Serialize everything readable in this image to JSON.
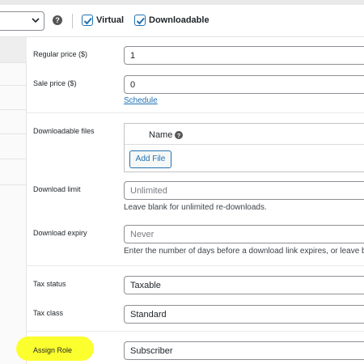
{
  "topbar": {
    "product_type_select": {
      "value": "",
      "icon": "chevron-down-icon"
    },
    "help_icon": "question-circle-icon",
    "virtual": {
      "label": "Virtual",
      "checked": true
    },
    "downloadable": {
      "label": "Downloadable",
      "checked": true
    }
  },
  "fields": {
    "regular_price": {
      "label": "Regular price ($)",
      "value": "1"
    },
    "sale_price": {
      "label": "Sale price ($)",
      "value": "0",
      "link": "Schedule"
    },
    "downloadable_files": {
      "label": "Downloadable files",
      "column_name": "Name",
      "add_button": "Add File"
    },
    "download_limit": {
      "label": "Download limit",
      "placeholder": "Unlimited",
      "hint": "Leave blank for unlimited re-downloads."
    },
    "download_expiry": {
      "label": "Download expiry",
      "placeholder": "Never",
      "hint": "Enter the number of days before a download link expires, or leave b"
    },
    "tax_status": {
      "label": "Tax status",
      "value": "Taxable"
    },
    "tax_class": {
      "label": "Tax class",
      "value": "Standard"
    },
    "assign_role": {
      "label": "Assign Role",
      "value": "Subscriber"
    }
  },
  "colors": {
    "accent": "#2271b1",
    "highlight": "#fcff2e"
  }
}
